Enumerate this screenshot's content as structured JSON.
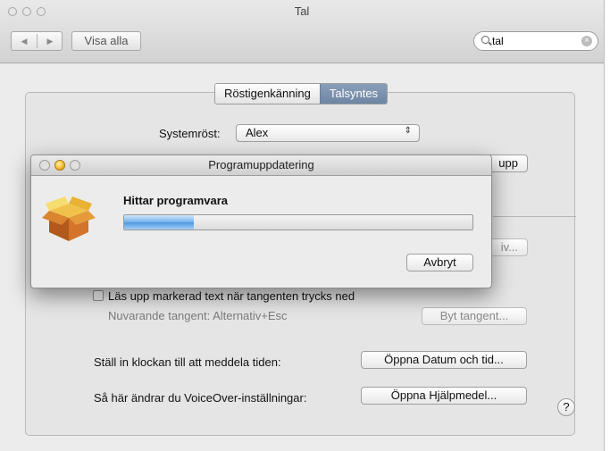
{
  "window": {
    "title": "Tal",
    "nav_back_icon": "◀",
    "nav_forward_icon": "▶",
    "show_all_label": "Visa alla",
    "search": {
      "value": "tal",
      "clear_icon": "×"
    }
  },
  "tabs": [
    {
      "label": "Röstigenkänning",
      "selected": false
    },
    {
      "label": "Talsyntes",
      "selected": true
    }
  ],
  "speech": {
    "system_voice_label": "Systemröst:",
    "system_voice_value": "Alex",
    "play_button_partial": "upp",
    "options_button_partial": "iv...",
    "read_selected_checkbox_label": "Läs upp markerad text när tangenten trycks ned",
    "read_selected_checked": false,
    "current_key_text": "Nuvarande tangent: Alternativ+Esc",
    "change_key_button": "Byt tangent...",
    "clock_label": "Ställ in klockan till att meddela tiden:",
    "open_datetime_button": "Öppna Datum och tid...",
    "voiceover_label": "Så här ändrar du VoiceOver-inställningar:",
    "open_accessibility_button": "Öppna Hjälpmedel...",
    "help_label": "?"
  },
  "dialog": {
    "title": "Programuppdatering",
    "status_text": "Hittar programvara",
    "progress": 0.2,
    "cancel_button": "Avbryt"
  }
}
